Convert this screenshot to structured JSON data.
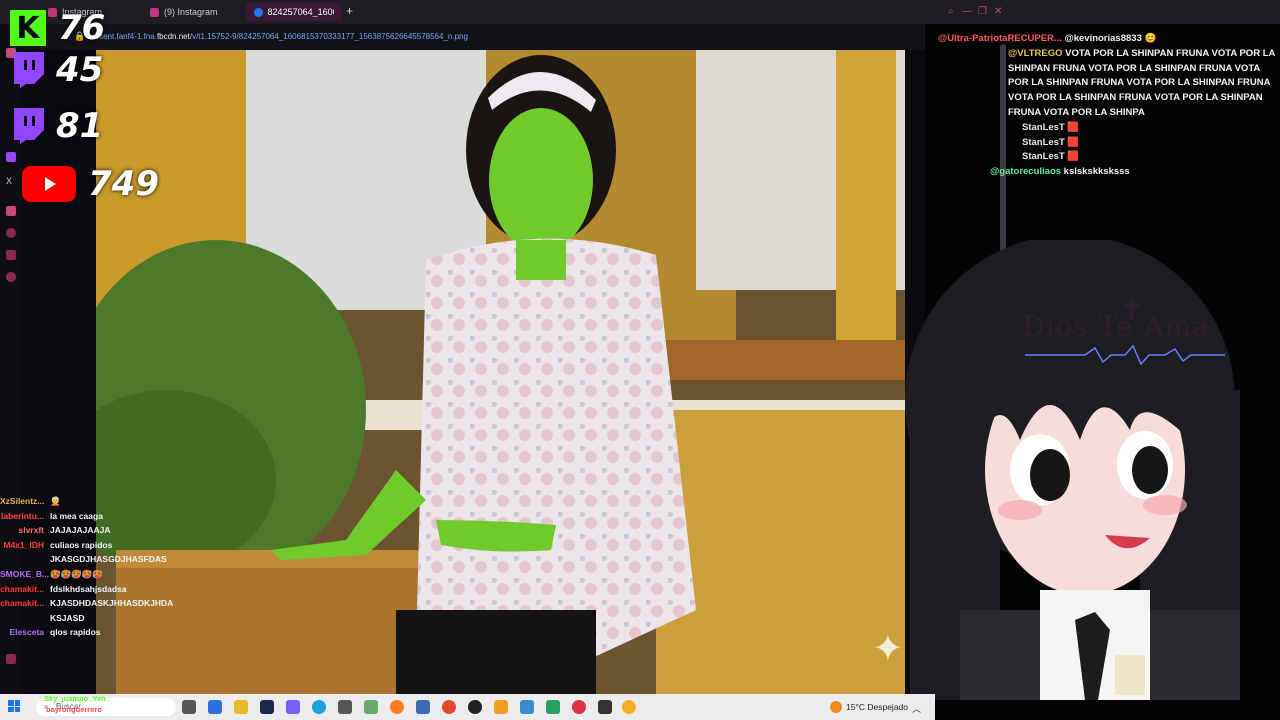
{
  "browser": {
    "tabs": [
      {
        "label": "Instagram",
        "active": false
      },
      {
        "label": "(9) Instagram",
        "active": false
      },
      {
        "label": "824257064_1606815370...",
        "active": true
      }
    ],
    "url_prefix": "content.fanf4-1.fna.",
    "url_domain": "fbcdn.net",
    "url_suffix": "/v/t1.15752-9/824257064_1606815370333177_1563875626645578564_n.png"
  },
  "counters": [
    {
      "platform": "kick",
      "value": "76"
    },
    {
      "platform": "twitch",
      "value": "45"
    },
    {
      "platform": "twitch",
      "value": "81"
    },
    {
      "platform": "youtube",
      "value": "749"
    }
  ],
  "left_chat": [
    {
      "user": "XzSilentz...",
      "color": "#e8b04a",
      "msg": "🧑‍🦳"
    },
    {
      "user": "laberintu...",
      "color": "#ff4a4a",
      "msg": "la mea caaga"
    },
    {
      "user": "slvrxft",
      "color": "#ff6a6a",
      "msg": "JAJAJAJAAJA"
    },
    {
      "user": "M4x1_IDH",
      "color": "#ff3a3a",
      "msg": "culiaos rapidos"
    },
    {
      "user": "",
      "color": "#ffffff",
      "msg": "JKASGDJHASGDJHASFDAS"
    },
    {
      "user": "SMOKE_B...",
      "color": "#b06cff",
      "msg": "🥵🥵🥵🥵🥵"
    },
    {
      "user": "chamakit...",
      "color": "#ff3a3a",
      "msg": "fdslkhdsahjsdadsa"
    },
    {
      "user": "chamakit...",
      "color": "#ff3a3a",
      "msg": "KJASDHDASKJHHASDKJHDA"
    },
    {
      "user": "",
      "color": "#ffffff",
      "msg": "KSJASD"
    },
    {
      "user": "Elesceta",
      "color": "#b06cff",
      "msg": "qlos rapidos"
    }
  ],
  "right_chat": [
    {
      "user": "@Ultra-PatriotaRECUPER...",
      "color": "#ff5a5a",
      "msg": "@kevinorias8833 😊"
    },
    {
      "user": "@VLTREGO",
      "color": "#e8c24a",
      "msg": "VOTA POR LA SHINPAN FRUNA VOTA POR LA SHINPAN FRUNA VOTA POR LA SHINPAN FRUNA VOTA POR LA SHINPAN FRUNA VOTA POR LA SHINPAN FRUNA VOTA POR LA SHINPAN FRUNA VOTA POR LA SHINPAN FRUNA VOTA POR LA SHINPA"
    },
    {
      "user": "StanLesT",
      "color": "#e8e8e8",
      "msg": "🟥"
    },
    {
      "user": "StanLesT",
      "color": "#e8e8e8",
      "msg": "🟥"
    },
    {
      "user": "StanLesT",
      "color": "#e8e8e8",
      "msg": "🟥"
    },
    {
      "user": "@gatoreculiaos",
      "color": "#5ef0a0",
      "msg": "kslskskksksss"
    }
  ],
  "vtuber": {
    "banner_text": "Dios Te Ama"
  },
  "taskbar": {
    "search_placeholder": "Buscar",
    "weather": "15°C  Despejado",
    "overlay_user_1": "Sky_juampo_Yeh",
    "overlay_user_2": "bayronguerrero"
  },
  "colors": {
    "kick": "#53fc18",
    "twitch": "#9146ff",
    "youtube": "#ff0000"
  }
}
